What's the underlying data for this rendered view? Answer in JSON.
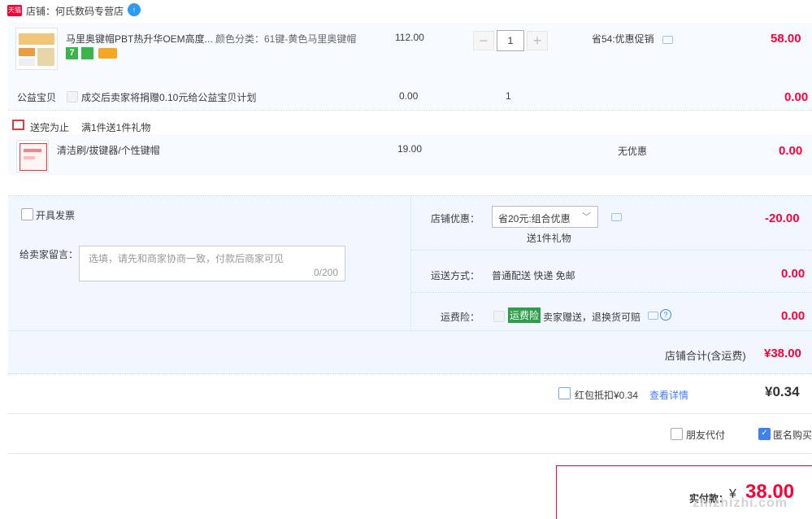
{
  "shop": {
    "badge": "天猫",
    "label": "店铺：",
    "name": "何氏数码专营店",
    "chat_badge": "↑"
  },
  "item1": {
    "title": "马里奥键帽PBT热升华OEM高度...",
    "spec": "颜色分类：61键-黄色马里奥键帽",
    "price": "112.00",
    "qty": "1",
    "promo": "省54:优惠促销",
    "total": "58.00",
    "badge_7": "7",
    "colors": {
      "green": "#3bb44a",
      "card": "#f5a623"
    }
  },
  "charity": {
    "label": "公益宝贝",
    "text": "成交后卖家将捐赠0.10元给公益宝贝计划",
    "price": "0.00",
    "qty": "1",
    "total": "0.00"
  },
  "gift": {
    "tag": "送完为止",
    "desc": "满1件送1件礼物"
  },
  "item2": {
    "title": "清洁刷/拔键器/个性键帽",
    "price": "19.00",
    "promo": "无优惠",
    "total": "0.00"
  },
  "invoice": {
    "label": "开具发票"
  },
  "message": {
    "label": "给卖家留言：",
    "placeholder": "选填，请先和商家协商一致，付款后商家可见",
    "counter": "0/200"
  },
  "discount": {
    "label": "店铺优惠：",
    "select": "省20元:组合优惠",
    "sub": "送1件礼物",
    "amount": "-20.00"
  },
  "shipping": {
    "label": "运送方式：",
    "value": "普通配送 快递 免邮",
    "amount": "0.00"
  },
  "insurance": {
    "label": "运费险：",
    "tag": "运费险",
    "text": "卖家赠送，退换货可赔",
    "help": "?",
    "amount": "0.00"
  },
  "shop_total": {
    "label": "店铺合计(含运费)",
    "value": "¥38.00"
  },
  "redpacket": {
    "label": "红包抵扣¥0.34",
    "link": "查看详情",
    "value": "¥0.34"
  },
  "options": {
    "friend_pay": "朋友代付",
    "anonymous": "匿名购买"
  },
  "final": {
    "label": "实付款：",
    "currency": "¥",
    "value": "38.00"
  },
  "watermark": "zhizhizhi.com",
  "accent": "#ff0036",
  "blue": "#3f81f2"
}
